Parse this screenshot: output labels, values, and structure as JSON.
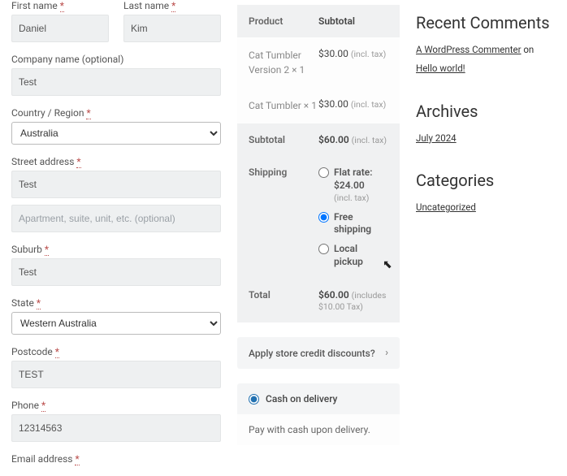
{
  "form": {
    "first_name": {
      "label": "First name",
      "req": "*",
      "value": "Daniel"
    },
    "last_name": {
      "label": "Last name",
      "req": "*",
      "value": "Kim"
    },
    "company": {
      "label": "Company name (optional)",
      "value": "Test"
    },
    "country": {
      "label": "Country / Region",
      "req": "*",
      "value": "Australia"
    },
    "street": {
      "label": "Street address",
      "req": "*",
      "value": "Test",
      "placeholder2": "Apartment, suite, unit, etc. (optional)"
    },
    "suburb": {
      "label": "Suburb",
      "req": "*",
      "value": "Test"
    },
    "state": {
      "label": "State",
      "req": "*",
      "value": "Western Australia"
    },
    "postcode": {
      "label": "Postcode",
      "req": "*",
      "value": "TEST"
    },
    "phone": {
      "label": "Phone",
      "req": "*",
      "value": "12314563"
    },
    "email": {
      "label": "Email address",
      "req": "*"
    }
  },
  "order": {
    "head_product": "Product",
    "head_subtotal": "Subtotal",
    "items": [
      {
        "name": "Cat Tumbler Version 2  × 1",
        "price": "$30.00",
        "tax": "(incl. tax)"
      },
      {
        "name": "Cat Tumbler × 1",
        "price": "$30.00",
        "tax": "(incl. tax)"
      }
    ],
    "subtotal_label": "Subtotal",
    "subtotal_value": "$60.00",
    "subtotal_tax": "(incl. tax)",
    "shipping_label": "Shipping",
    "shipping_opts": [
      {
        "label": "Flat rate:",
        "price": "$24.00",
        "tax": "(incl. tax)"
      },
      {
        "label": "Free shipping"
      },
      {
        "label": "Local pickup"
      }
    ],
    "total_label": "Total",
    "total_value": "$60.00",
    "total_tax": "(includes $10.00 Tax)"
  },
  "credit_panel": "Apply store credit discounts?",
  "payment": {
    "method": "Cash on delivery",
    "desc": "Pay with cash upon delivery."
  },
  "sidebar": {
    "recent_h": "Recent Comments",
    "commenter": "A WordPress Commenter",
    "on": " on ",
    "post": "Hello world!",
    "archives_h": "Archives",
    "archive1": "July 2024",
    "categories_h": "Categories",
    "cat1": "Uncategorized"
  }
}
